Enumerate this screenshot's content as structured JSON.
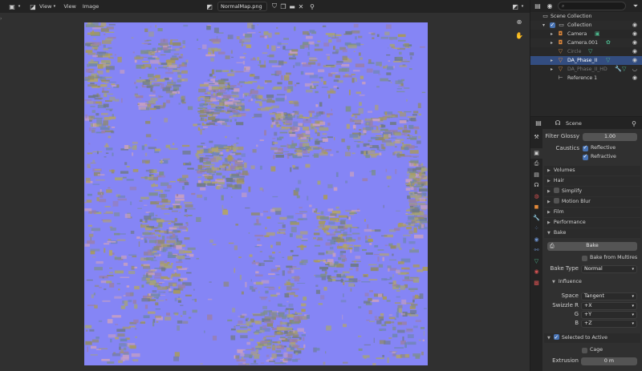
{
  "image_editor": {
    "header": {
      "menus": [
        "View",
        "View",
        "Image"
      ],
      "image_name": "NormalMap.png"
    }
  },
  "outliner": {
    "search_placeholder": "",
    "items": [
      {
        "label": "Scene Collection"
      },
      {
        "label": "Collection"
      },
      {
        "label": "Camera"
      },
      {
        "label": "Camera.001"
      },
      {
        "label": "Circle"
      },
      {
        "label": "DA_Phase_II"
      },
      {
        "label": "DA_Phase_II_HD"
      },
      {
        "label": "Reference 1"
      }
    ]
  },
  "properties": {
    "context": "Scene",
    "filter_glossy": {
      "label": "Filter Glossy",
      "value": "1.00"
    },
    "caustics": {
      "label": "Caustics",
      "reflective": "Reflective",
      "refractive": "Refractive"
    },
    "panels": [
      "Volumes",
      "Hair",
      "Simplify",
      "Motion Blur",
      "Film",
      "Performance",
      "Bake"
    ],
    "bake": {
      "button": "Bake",
      "from_multires": "Bake from Multires",
      "type_label": "Bake Type",
      "type_value": "Normal",
      "influence": "Influence",
      "space_label": "Space",
      "space_value": "Tangent",
      "swizzle_r_label": "Swizzle R",
      "swizzle_r_value": "+X",
      "g_label": "G",
      "g_value": "+Y",
      "b_label": "B",
      "b_value": "+Z",
      "selected_to_active": "Selected to Active",
      "cage": "Cage",
      "extrusion_label": "Extrusion",
      "extrusion_value": "0 m"
    }
  },
  "colors": {
    "normal_map_base": "#8585f5",
    "selection": "#334d80",
    "accent": "#4772b3"
  }
}
